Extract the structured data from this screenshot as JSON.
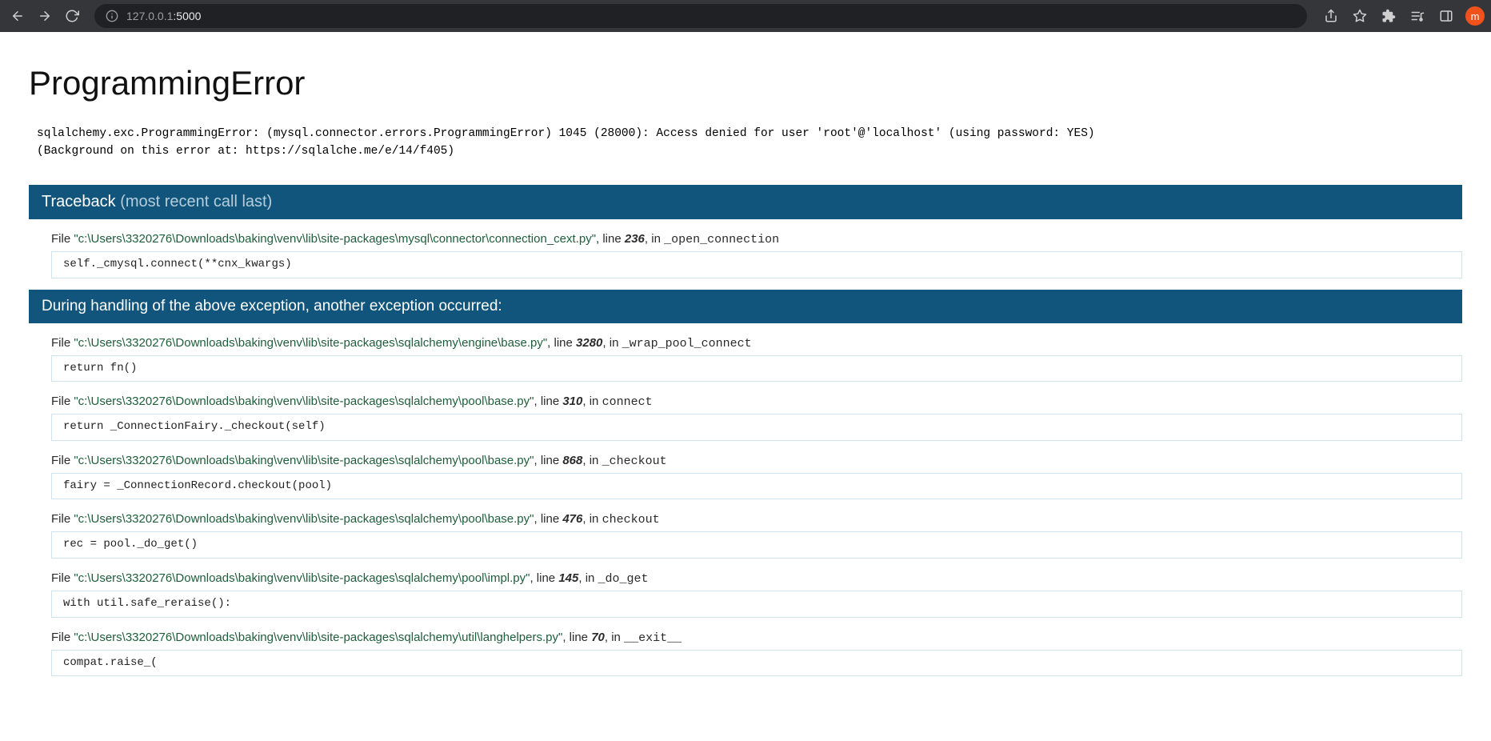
{
  "browser": {
    "url_dim_prefix": "127.0.0.1",
    "url_rest": ":5000",
    "profile_letter": "m"
  },
  "page": {
    "title": "ProgrammingError",
    "detail": "sqlalchemy.exc.ProgrammingError: (mysql.connector.errors.ProgrammingError) 1045 (28000): Access denied for user 'root'@'localhost' (using password: YES)\n(Background on this error at: https://sqlalche.me/e/14/f405)",
    "traceback_label": "Traceback ",
    "traceback_hint": "(most recent call last)",
    "sub_banner": "During handling of the above exception, another exception occurred:",
    "frames_a": [
      {
        "file_prefix": "File ",
        "path": "\"c:\\Users\\3320276\\Downloads\\baking\\venv\\lib\\site-packages\\mysql\\connector\\connection_cext.py\"",
        "line_label": ", line ",
        "line": "236",
        "in_label": ", in ",
        "func": "_open_connection",
        "code": "self._cmysql.connect(**cnx_kwargs)"
      }
    ],
    "frames_b": [
      {
        "file_prefix": "File ",
        "path": "\"c:\\Users\\3320276\\Downloads\\baking\\venv\\lib\\site-packages\\sqlalchemy\\engine\\base.py\"",
        "line_label": ", line ",
        "line": "3280",
        "in_label": ", in ",
        "func": "_wrap_pool_connect",
        "code": "return fn()"
      },
      {
        "file_prefix": "File ",
        "path": "\"c:\\Users\\3320276\\Downloads\\baking\\venv\\lib\\site-packages\\sqlalchemy\\pool\\base.py\"",
        "line_label": ", line ",
        "line": "310",
        "in_label": ", in ",
        "func": "connect",
        "code": "return _ConnectionFairy._checkout(self)"
      },
      {
        "file_prefix": "File ",
        "path": "\"c:\\Users\\3320276\\Downloads\\baking\\venv\\lib\\site-packages\\sqlalchemy\\pool\\base.py\"",
        "line_label": ", line ",
        "line": "868",
        "in_label": ", in ",
        "func": "_checkout",
        "code": "fairy = _ConnectionRecord.checkout(pool)"
      },
      {
        "file_prefix": "File ",
        "path": "\"c:\\Users\\3320276\\Downloads\\baking\\venv\\lib\\site-packages\\sqlalchemy\\pool\\base.py\"",
        "line_label": ", line ",
        "line": "476",
        "in_label": ", in ",
        "func": "checkout",
        "code": "rec = pool._do_get()"
      },
      {
        "file_prefix": "File ",
        "path": "\"c:\\Users\\3320276\\Downloads\\baking\\venv\\lib\\site-packages\\sqlalchemy\\pool\\impl.py\"",
        "line_label": ", line ",
        "line": "145",
        "in_label": ", in ",
        "func": "_do_get",
        "code": "with util.safe_reraise():"
      },
      {
        "file_prefix": "File ",
        "path": "\"c:\\Users\\3320276\\Downloads\\baking\\venv\\lib\\site-packages\\sqlalchemy\\util\\langhelpers.py\"",
        "line_label": ", line ",
        "line": "70",
        "in_label": ", in ",
        "func": "__exit__",
        "code": "compat.raise_("
      }
    ]
  }
}
